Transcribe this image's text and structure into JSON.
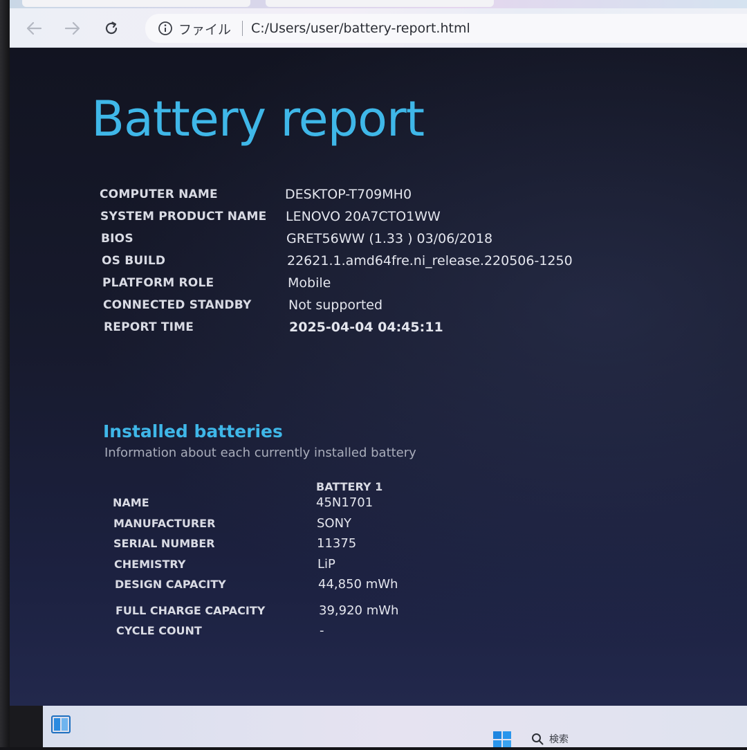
{
  "browser": {
    "url_scheme": "ファイル",
    "url": "C:/Users/user/battery-report.html"
  },
  "page": {
    "title": "Battery report",
    "system_info": [
      {
        "label": "COMPUTER NAME",
        "value": "DESKTOP-T709MH0"
      },
      {
        "label": "SYSTEM PRODUCT NAME",
        "value": "LENOVO 20A7CTO1WW"
      },
      {
        "label": "BIOS",
        "value": "GRET56WW (1.33 ) 03/06/2018"
      },
      {
        "label": "OS BUILD",
        "value": "22621.1.amd64fre.ni_release.220506-1250"
      },
      {
        "label": "PLATFORM ROLE",
        "value": "Mobile"
      },
      {
        "label": "CONNECTED STANDBY",
        "value": "Not supported"
      },
      {
        "label": "REPORT TIME",
        "value": "2025-04-04  04:45:11"
      }
    ],
    "installed_batteries": {
      "title": "Installed batteries",
      "subtitle": "Information about each currently installed battery",
      "column_header": "BATTERY 1",
      "rows": [
        {
          "label": "NAME",
          "value": "45N1701"
        },
        {
          "label": "MANUFACTURER",
          "value": "SONY"
        },
        {
          "label": "SERIAL NUMBER",
          "value": "11375"
        },
        {
          "label": "CHEMISTRY",
          "value": "LiP"
        },
        {
          "label": "DESIGN CAPACITY",
          "value": "44,850 mWh"
        },
        {
          "label": "FULL CHARGE CAPACITY",
          "value": "39,920 mWh"
        },
        {
          "label": "CYCLE COUNT",
          "value": "-"
        }
      ]
    }
  },
  "taskbar": {
    "search_label": "検索"
  },
  "colors": {
    "accent": "#3fb7e8",
    "page_background": "#171a2d",
    "text": "#e4e6ee"
  },
  "icons": {
    "back": "back-arrow-icon",
    "forward": "forward-arrow-icon",
    "reload": "reload-icon",
    "info": "info-icon",
    "start": "windows-start-icon",
    "search": "search-icon",
    "task_view": "task-view-icon"
  }
}
